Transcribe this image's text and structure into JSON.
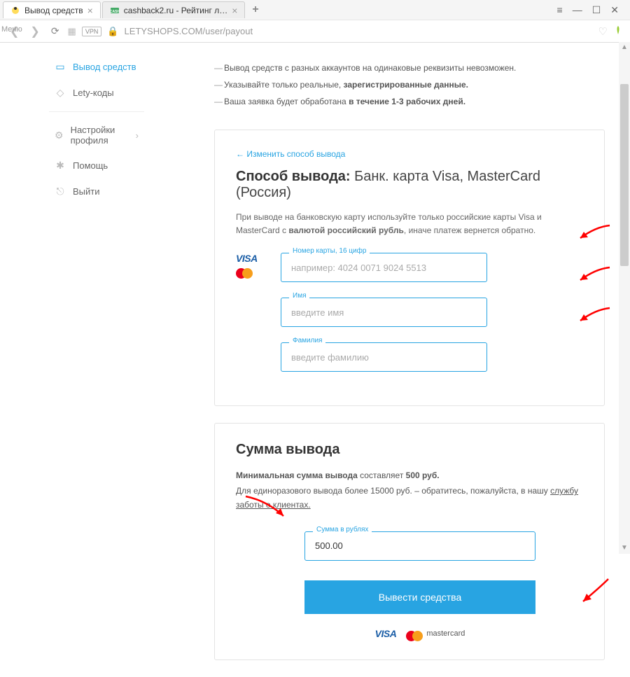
{
  "browser": {
    "tabs": [
      {
        "title": "Вывод средств",
        "active": true
      },
      {
        "title": "cashback2.ru - Рейтинг л…",
        "active": false
      }
    ],
    "url": "LETYSHOPS.COM/user/payout",
    "vpn": "VPN",
    "menu_label": "Меню"
  },
  "sidebar": {
    "items": [
      {
        "label": "Вывод средств",
        "icon": "wallet"
      },
      {
        "label": "Lety-коды",
        "icon": "tag"
      },
      {
        "label": "Настройки профиля",
        "icon": "gear",
        "caret": true
      },
      {
        "label": "Помощь",
        "icon": "help"
      },
      {
        "label": "Выйти",
        "icon": "exit"
      }
    ]
  },
  "notes": {
    "line1": "Вывод средств с разных аккаунтов на одинаковые реквизиты невозможен.",
    "line2a": "Указывайте только реальные, ",
    "line2b": "зарегистрированные данные.",
    "line3a": "Ваша заявка будет обработана ",
    "line3b": "в течение 1-3 рабочих дней."
  },
  "method": {
    "back": "← Изменить способ вывода",
    "title_bold": "Способ вывода: ",
    "title_rest": "Банк. карта Visa, MasterCard (Россия)",
    "desc_a": "При выводе на банковскую карту используйте только российские карты Visa и MasterCard с ",
    "desc_b": "валютой российский рубль",
    "desc_c": ", иначе платеж вернется обратно.",
    "fields": {
      "card": {
        "label": "Номер карты, 16 цифр",
        "placeholder": "например: 4024 0071 9024 5513"
      },
      "fname": {
        "label": "Имя",
        "placeholder": "введите имя"
      },
      "lname": {
        "label": "Фамилия",
        "placeholder": "введите фамилию"
      }
    }
  },
  "amount": {
    "title": "Сумма вывода",
    "min_a": "Минимальная сумма вывода ",
    "min_b": "составляет ",
    "min_c": "500 руб.",
    "help_a": "Для единоразового вывода более 15000 руб. – обратитесь, пожалуйста, в нашу ",
    "help_link": "службу заботы о клиентах.",
    "field": {
      "label": "Сумма в рублях",
      "value": "500.00"
    },
    "submit": "Вывести средства",
    "mc_label": "mastercard"
  }
}
